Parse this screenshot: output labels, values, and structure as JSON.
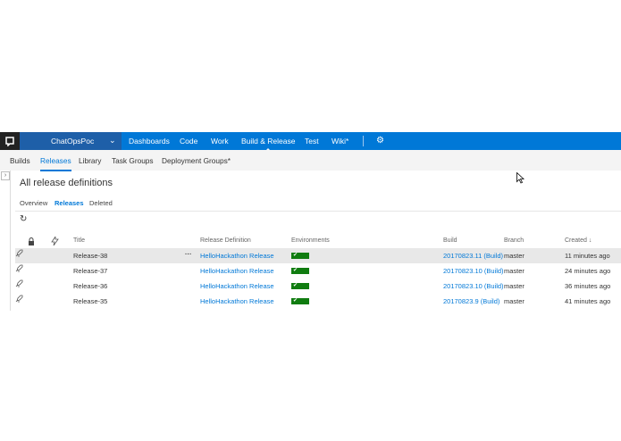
{
  "topnav": {
    "project": "ChatOpsPoc",
    "items": [
      {
        "label": "Dashboards"
      },
      {
        "label": "Code"
      },
      {
        "label": "Work"
      },
      {
        "label": "Build & Release"
      },
      {
        "label": "Test"
      },
      {
        "label": "Wiki*"
      }
    ]
  },
  "subnav": {
    "items": [
      {
        "label": "Builds"
      },
      {
        "label": "Releases"
      },
      {
        "label": "Library"
      },
      {
        "label": "Task Groups"
      },
      {
        "label": "Deployment Groups*"
      }
    ]
  },
  "page": {
    "title": "All release definitions",
    "tabs": [
      "Overview",
      "Releases",
      "Deleted"
    ]
  },
  "table": {
    "headers": {
      "title": "Title",
      "definition": "Release Definition",
      "environments": "Environments",
      "build": "Build",
      "branch": "Branch",
      "created": "Created"
    },
    "rows": [
      {
        "title": "Release-38",
        "definition": "HelloHackathon Release",
        "build": "20170823.11 (Build)",
        "branch": "master",
        "created": "11 minutes ago"
      },
      {
        "title": "Release-37",
        "definition": "HelloHackathon Release",
        "build": "20170823.10 (Build)",
        "branch": "master",
        "created": "24 minutes ago"
      },
      {
        "title": "Release-36",
        "definition": "HelloHackathon Release",
        "build": "20170823.10 (Build)",
        "branch": "master",
        "created": "36 minutes ago"
      },
      {
        "title": "Release-35",
        "definition": "HelloHackathon Release",
        "build": "20170823.9 (Build)",
        "branch": "master",
        "created": "41 minutes ago"
      }
    ]
  },
  "colors": {
    "accent": "#0078d7",
    "nav_bg": "#0078d7",
    "env_success": "#107c10"
  },
  "icons": {
    "logo": "vsts-logo-icon",
    "gear": "gear-icon",
    "refresh": "refresh-icon",
    "lock": "lock-icon",
    "rocket": "release-icon",
    "sort": "sort-down-icon",
    "more": "ellipsis-icon"
  }
}
